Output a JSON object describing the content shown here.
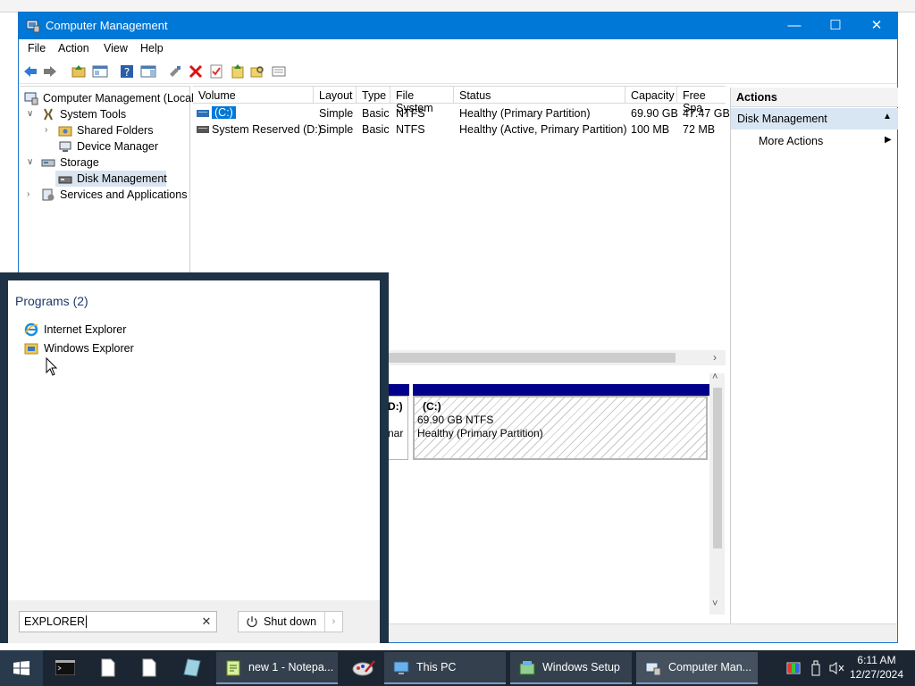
{
  "window": {
    "title": "Computer Management",
    "minimize": "—",
    "maximize": "☐",
    "close": "✕"
  },
  "menu": [
    "File",
    "Action",
    "View",
    "Help"
  ],
  "tree": {
    "root": "Computer Management (Local",
    "system_tools": "System Tools",
    "shared_folders": "Shared Folders",
    "device_manager": "Device Manager",
    "storage": "Storage",
    "disk_management": "Disk Management",
    "services": "Services and Applications"
  },
  "columns": [
    "Volume",
    "Layout",
    "Type",
    "File System",
    "Status",
    "Capacity",
    "Free Spa"
  ],
  "volumes": [
    {
      "volume": "(C:)",
      "layout": "Simple",
      "type": "Basic",
      "fs": "NTFS",
      "status": "Healthy (Primary Partition)",
      "capacity": "69.90 GB",
      "free": "47.47 GB"
    },
    {
      "volume": "System Reserved (D:)",
      "layout": "Simple",
      "type": "Basic",
      "fs": "NTFS",
      "status": "Healthy (Active, Primary Partition)",
      "capacity": "100 MB",
      "free": "72 MB"
    }
  ],
  "disk_map": {
    "partD_line1": "D:)",
    "partD_line2": "nar",
    "partC_name": "(C:)",
    "partC_size": "69.90 GB NTFS",
    "partC_status": "Healthy (Primary Partition)"
  },
  "actions": {
    "header": "Actions",
    "section": "Disk Management",
    "more": "More Actions"
  },
  "start_menu": {
    "programs_header": "Programs (2)",
    "programs": [
      "Internet Explorer",
      "Windows Explorer"
    ],
    "search_value": "EXPLORER",
    "shutdown_label": "Shut down"
  },
  "taskbar": {
    "tasks": [
      "new 1 - Notepa...",
      "This PC",
      "Windows Setup",
      "Computer Man..."
    ],
    "time": "6:11 AM",
    "date": "12/27/2024"
  },
  "colors": {
    "titlebar": "#0078d7",
    "taskbar": "#1c2632",
    "start_menu": "#1f3346",
    "disk_header": "#00008b",
    "selection": "#0078d7"
  }
}
